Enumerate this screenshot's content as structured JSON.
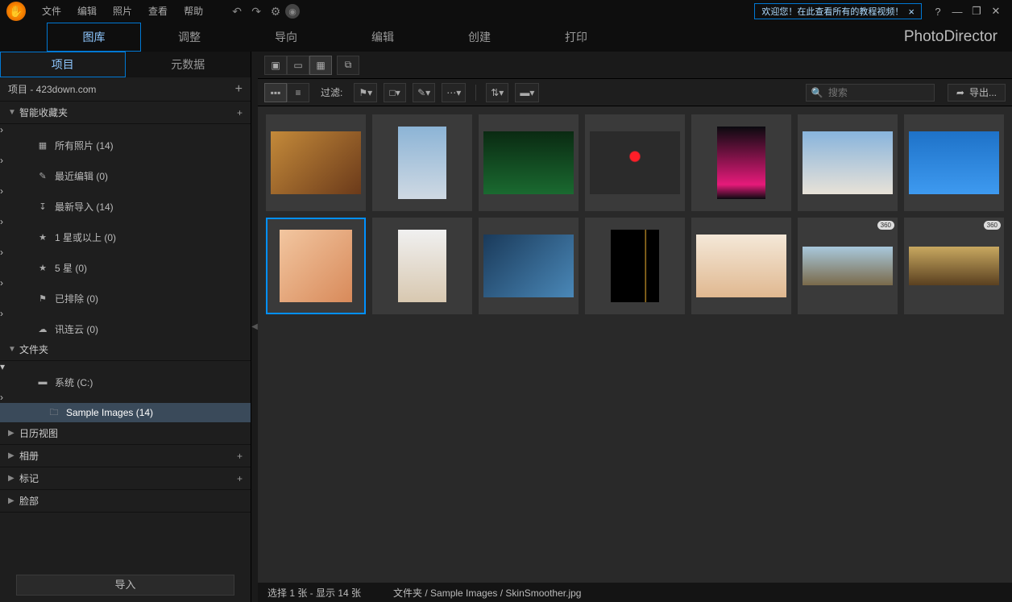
{
  "menu": {
    "file": "文件",
    "edit": "编辑",
    "photo": "照片",
    "view": "查看",
    "help": "帮助"
  },
  "welcome": {
    "text": "欢迎您！在此查看所有的教程视频！"
  },
  "brand": "PhotoDirector",
  "main_tabs": {
    "library": "图库",
    "adjust": "调整",
    "guided": "导向",
    "edit": "编辑",
    "create": "创建",
    "print": "打印"
  },
  "side_tabs": {
    "project": "项目",
    "metadata": "元数据"
  },
  "project_header": "项目 - 423down.com",
  "sections": {
    "smart": "智能收藏夹",
    "folders": "文件夹",
    "calendar": "日历视图",
    "albums": "相册",
    "tags": "标记",
    "faces": "脸部"
  },
  "smart_items": {
    "all": "所有照片 (14)",
    "recent": "最近编辑 (0)",
    "latest": "最新导入 (14)",
    "star1": "1 星或以上 (0)",
    "star5": "5 星 (0)",
    "reject": "已排除 (0)",
    "cloud": "讯连云 (0)"
  },
  "folder_items": {
    "system": "系统 (C:)",
    "sample": "Sample Images (14)"
  },
  "import_btn": "导入",
  "toolbar": {
    "filter": "过滤:"
  },
  "search": {
    "placeholder": "搜索"
  },
  "export": "导出...",
  "status": {
    "selection": "选择 1 张 - 显示 14 张",
    "path": "文件夹 / Sample Images / SkinSmoother.jpg"
  },
  "thumbs": [
    {
      "shape": "th-land",
      "art": "img-basketball",
      "sel": false,
      "b360": false
    },
    {
      "shape": "th-port",
      "art": "img-rock",
      "sel": false,
      "b360": false
    },
    {
      "shape": "th-land",
      "art": "img-forest",
      "sel": false,
      "b360": false
    },
    {
      "shape": "th-land",
      "art": "img-leaf",
      "sel": false,
      "b360": false
    },
    {
      "shape": "th-port",
      "art": "img-neon",
      "sel": false,
      "b360": false
    },
    {
      "shape": "th-land",
      "art": "img-rocket",
      "sel": false,
      "b360": false
    },
    {
      "shape": "th-land",
      "art": "img-skate",
      "sel": false,
      "b360": false
    },
    {
      "shape": "th-sq",
      "art": "img-woman1",
      "sel": true,
      "b360": false
    },
    {
      "shape": "th-port",
      "art": "img-woman2",
      "sel": false,
      "b360": false
    },
    {
      "shape": "th-land",
      "art": "img-wave",
      "sel": false,
      "b360": false
    },
    {
      "shape": "th-port",
      "art": "img-window",
      "sel": false,
      "b360": false
    },
    {
      "shape": "th-land",
      "art": "img-woman3",
      "sel": false,
      "b360": false
    },
    {
      "shape": "th-pano",
      "art": "img-pano1",
      "sel": false,
      "b360": true
    },
    {
      "shape": "th-pano",
      "art": "img-pano2",
      "sel": false,
      "b360": true
    }
  ],
  "badge360": "360"
}
